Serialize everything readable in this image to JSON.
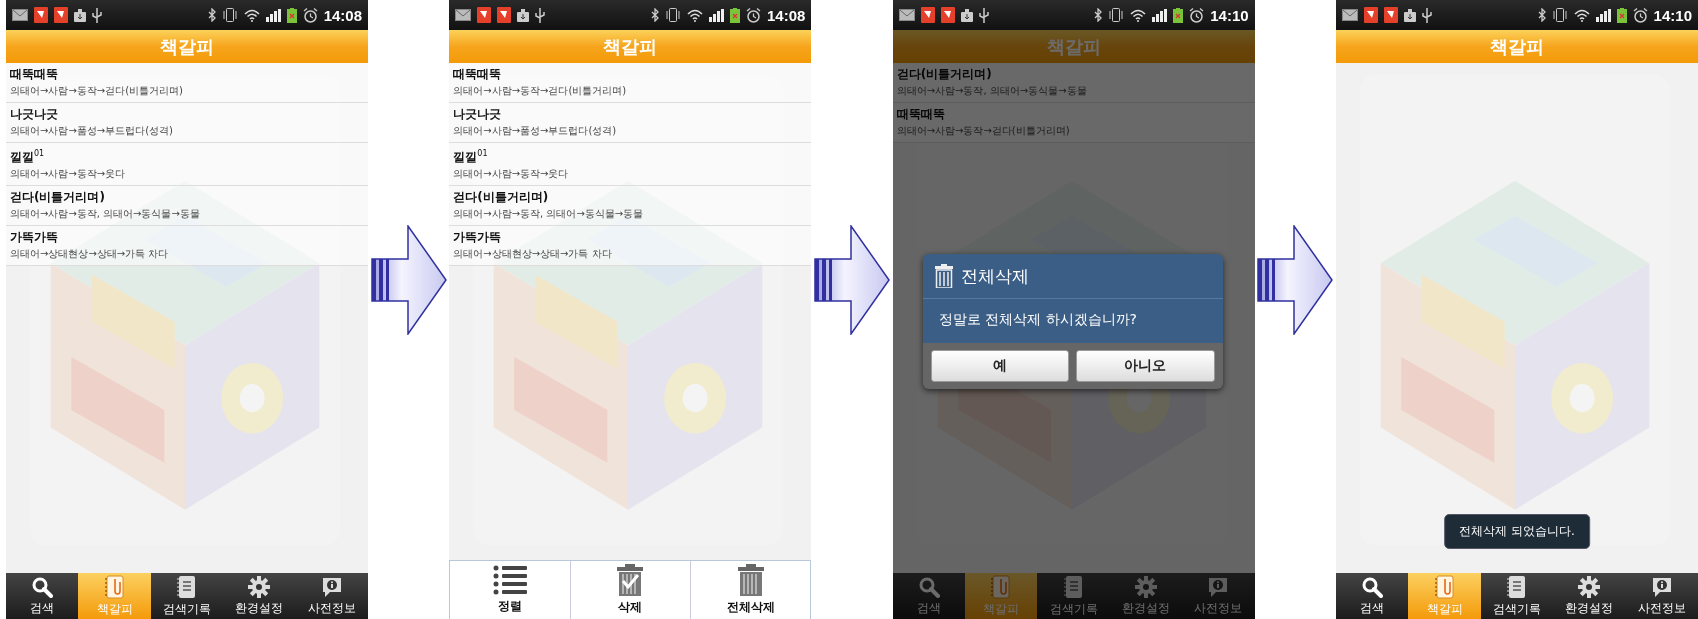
{
  "screens": [
    {
      "status_bar": {
        "time": "14:08"
      },
      "title": "책갈피",
      "entries": [
        {
          "word": "때뚝때뚝",
          "path": "의태어→사람→동작→걷다(비틀거리며)"
        },
        {
          "word": "나긋나긋",
          "path": "의태어→사람→품성→부드럽다(성격)"
        },
        {
          "word": "낄낄$^{01}$",
          "path": "의태어→사람→동작→웃다"
        },
        {
          "word": "걷다(비틀거리며)",
          "path": "의태어→사람→동작, 의태어→동식물→동물"
        },
        {
          "word": "가뜩가뜩",
          "path": "의태어→상태현상→상태→가득 차다"
        }
      ],
      "bottom_bar": {
        "kind": "tabs",
        "items": [
          {
            "label": "검색",
            "selected": false
          },
          {
            "label": "책갈피",
            "selected": true
          },
          {
            "label": "검색기록",
            "selected": false
          },
          {
            "label": "환경설정",
            "selected": false
          },
          {
            "label": "사전정보",
            "selected": false
          }
        ]
      }
    },
    {
      "status_bar": {
        "time": "14:08"
      },
      "title": "책갈피",
      "entries": [
        {
          "word": "때뚝때뚝",
          "path": "의태어→사람→동작→걷다(비틀거리며)"
        },
        {
          "word": "나긋나긋",
          "path": "의태어→사람→품성→부드럽다(성격)"
        },
        {
          "word": "낄낄$^{01}$",
          "path": "의태어→사람→동작→웃다"
        },
        {
          "word": "걷다(비틀거리며)",
          "path": "의태어→사람→동작, 의태어→동식물→동물"
        },
        {
          "word": "가뜩가뜩",
          "path": "의태어→상태현상→상태→가득 차다"
        }
      ],
      "bottom_bar": {
        "kind": "menu",
        "items": [
          {
            "label": "정렬"
          },
          {
            "label": "삭제"
          },
          {
            "label": "전체삭제"
          }
        ]
      }
    },
    {
      "status_bar": {
        "time": "14:10"
      },
      "title": "책갈피",
      "dimmed": true,
      "entries": [
        {
          "word": "걷다(비틀거리며)",
          "path": "의태어→사람→동작, 의태어→동식물→동물"
        },
        {
          "word": "때뚝때뚝",
          "path": "의태어→사람→동작→걷다(비틀거리며)"
        }
      ],
      "bottom_bar": {
        "kind": "tabs",
        "items": [
          {
            "label": "검색",
            "selected": false
          },
          {
            "label": "책갈피",
            "selected": true
          },
          {
            "label": "검색기록",
            "selected": false
          },
          {
            "label": "환경설정",
            "selected": false
          },
          {
            "label": "사전정보",
            "selected": false
          }
        ]
      },
      "dialog": {
        "title": "전체삭제",
        "message": "정말로 전체삭제 하시겠습니까?",
        "buttons": [
          {
            "label": "예"
          },
          {
            "label": "아니오"
          }
        ]
      }
    },
    {
      "status_bar": {
        "time": "14:10"
      },
      "title": "책갈피",
      "bottom_bar": {
        "kind": "tabs",
        "items": [
          {
            "label": "검색",
            "selected": false
          },
          {
            "label": "책갈피",
            "selected": true
          },
          {
            "label": "검색기록",
            "selected": false
          },
          {
            "label": "환경설정",
            "selected": false
          },
          {
            "label": "사전정보",
            "selected": false
          }
        ]
      },
      "toast": "전체삭제 되었습니다."
    }
  ]
}
